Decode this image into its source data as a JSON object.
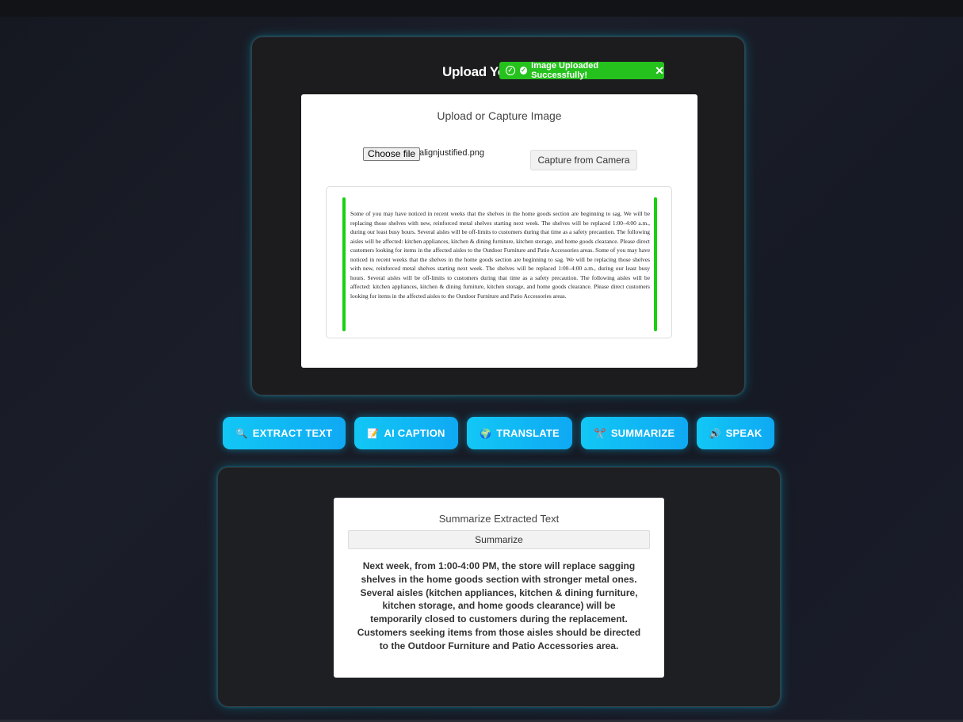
{
  "upload": {
    "title": "Upload Your Image",
    "panel_heading": "Upload or Capture Image",
    "choose_file_label": "Choose file",
    "file_name": "alignjustified.png",
    "capture_label": "Capture from Camera",
    "preview_text": "Some of you may have noticed in recent weeks that the shelves in the home goods section are beginning to sag. We will be replacing those shelves with new, reinforced metal shelves starting next week. The shelves will be replaced 1:00–4:00 a.m., during our least busy hours. Several aisles will be off-limits to customers during that time as a safety precaution. The following aisles will be affected: kitchen appliances, kitchen & dining furniture, kitchen storage, and home goods clearance. Please direct customers looking for items in the affected aisles to the Outdoor Furniture and Patio Accessories areas. Some of you may have noticed in recent weeks that the shelves in the home goods section are beginning to sag. We will be replacing those shelves with new, reinforced metal shelves starting next week. The shelves will be replaced 1:00–4:00 a.m., during our least busy hours. Several aisles will be off-limits to customers during that time as a safety precaution. The following aisles will be affected: kitchen appliances, kitchen & dining furniture, kitchen storage, and home goods clearance. Please direct customers looking for items in the affected aisles to the Outdoor Furniture and Patio Accessories areas."
  },
  "toast": {
    "message": "Image Uploaded Successfully!",
    "close": "✕",
    "color": "#25c21d"
  },
  "actions": [
    {
      "icon": "🔍",
      "icon_name": "magnifier-icon",
      "label": "EXTRACT TEXT"
    },
    {
      "icon": "📝",
      "icon_name": "memo-icon",
      "label": "AI CAPTION"
    },
    {
      "icon": "🌍",
      "icon_name": "globe-icon",
      "label": "TRANSLATE"
    },
    {
      "icon": "✂️",
      "icon_name": "scissors-icon",
      "label": "SUMMARIZE"
    },
    {
      "icon": "🔊",
      "icon_name": "speaker-icon",
      "label": "SPEAK"
    }
  ],
  "summary": {
    "heading": "Summarize Extracted Text",
    "button_label": "Summarize",
    "text": "Next week, from 1:00-4:00 PM, the store will replace sagging shelves in the home goods section with stronger metal ones. Several aisles (kitchen appliances, kitchen & dining furniture, kitchen storage, and home goods clearance) will be temporarily closed to customers during the replacement. Customers seeking items from those aisles should be directed to the Outdoor Furniture and Patio Accessories area."
  },
  "colors": {
    "accent": "#12c7f5",
    "success": "#25c21d",
    "card_glow": "#00dcff"
  }
}
